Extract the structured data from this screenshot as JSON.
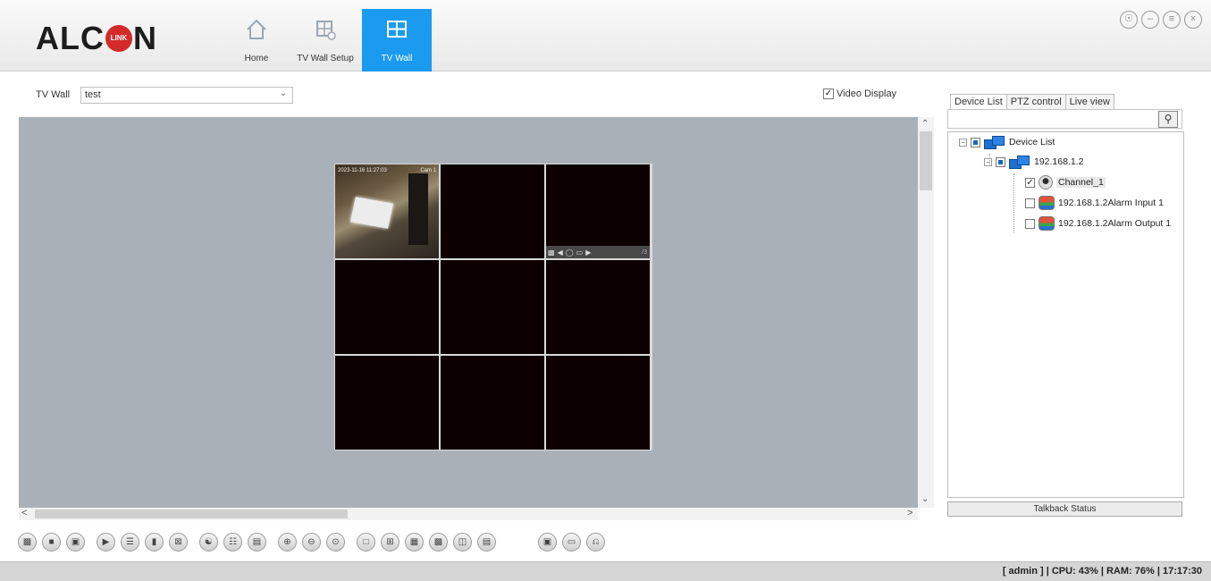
{
  "logo": {
    "text_left": "ALC",
    "text_right": "N",
    "badge": "LINK"
  },
  "nav": [
    {
      "label": "Home",
      "icon": "home-icon",
      "active": false
    },
    {
      "label": "TV Wall Setup",
      "icon": "wall-setup-icon",
      "active": false
    },
    {
      "label": "TV Wall",
      "icon": "tv-wall-icon",
      "active": true
    }
  ],
  "window_controls": [
    "lock-icon",
    "minimize-icon",
    "restore-icon",
    "close-icon"
  ],
  "wall": {
    "label": "TV Wall",
    "selected": "test"
  },
  "video_display": {
    "label": "Video Display",
    "checked": true
  },
  "grid_cells": 9,
  "cell0": {
    "osd_left": "2023-11-16 11:27:03",
    "osd_right": "Cam 1"
  },
  "cell2": {
    "number": "/3"
  },
  "panel": {
    "tabs": [
      "Device List",
      "PTZ control",
      "Live view"
    ],
    "active_tab": "Device List",
    "talkback": "Talkback Status"
  },
  "tree": {
    "root": "Device List",
    "device": "192.168.1.2",
    "channel": "Channel_1",
    "alarm_in": "192.168.1.2Alarm Input 1",
    "alarm_out": "192.168.1.2Alarm Output 1"
  },
  "status": "[ admin ] | CPU: 43% | RAM: 76% | 17:17:30"
}
